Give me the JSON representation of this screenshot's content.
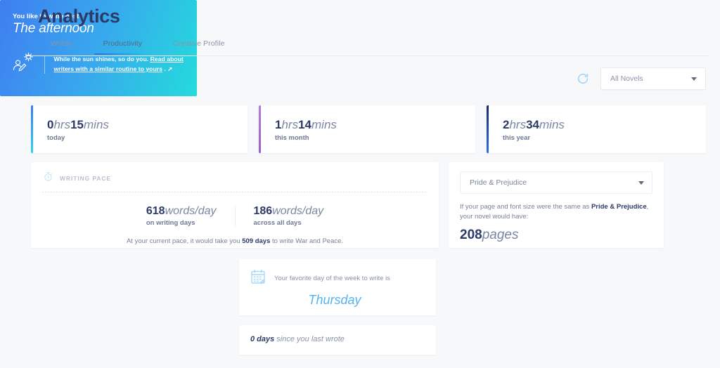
{
  "header": {
    "title": "Analytics",
    "tabs": [
      {
        "label": "Words",
        "active": false
      },
      {
        "label": "Productivity",
        "active": true
      },
      {
        "label": "Creative Profile",
        "active": false
      }
    ]
  },
  "toolbar": {
    "refresh_icon": "refresh-icon",
    "novel_filter": {
      "value": "All Novels",
      "caret": "chevron-down-icon"
    }
  },
  "stats": [
    {
      "num1": "0",
      "unit1": "hrs",
      "num2": "15",
      "unit2": "mins",
      "sub": "today",
      "accent": "#3a7bf0"
    },
    {
      "num1": "1",
      "unit1": "hrs",
      "num2": "14",
      "unit2": "mins",
      "sub": "this month",
      "accent": "#9a5fc9"
    },
    {
      "num1": "2",
      "unit1": "hrs",
      "num2": "34",
      "unit2": "mins",
      "sub": "this year",
      "accent": "#1b2a6b"
    }
  ],
  "writing_pace": {
    "icon": "stopwatch-icon",
    "title": "WRITING PACE",
    "figures": [
      {
        "num": "618",
        "unit": "words/day",
        "sub": "on writing days"
      },
      {
        "num": "186",
        "unit": "words/day",
        "sub": "across all days"
      }
    ],
    "note_before": "At your current pace, it would take you ",
    "note_bold": "509 days",
    "note_after": " to write War and Peace."
  },
  "pages_panel": {
    "select_value": "Pride & Prejudice",
    "caret": "chevron-down-icon",
    "note_before": "If your page and font size were the same as ",
    "note_bold": "Pride & Prejudice",
    "note_after": ", your novel would have:",
    "pages_num": "208",
    "pages_unit": "pages"
  },
  "time_of_day": {
    "kicker": "You like to write best",
    "value": "The afternoon",
    "icon": "writer-sun-icon",
    "text_before": "While the sun shines, so do you. ",
    "link": "Read about writers with a similar routine to yours",
    "text_after": " . ↗"
  },
  "favorite_day": {
    "icon": "calendar-icon",
    "label": "Your favorite day of the week to write is",
    "value": "Thursday"
  },
  "last_wrote": {
    "bold": "0 days",
    "text": " since you last wrote"
  }
}
